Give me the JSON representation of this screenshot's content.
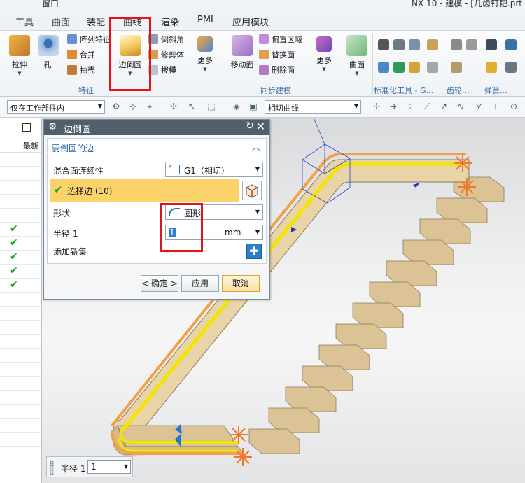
{
  "window": {
    "title": "NX 10 - 建模 - [几齿钉耙.prt",
    "menu_window": "窗口"
  },
  "menubar": {
    "items": [
      "工具",
      "曲面",
      "装配",
      "曲线",
      "渲染",
      "PMI",
      "应用模块"
    ]
  },
  "ribbon": {
    "buttons": {
      "extrude": "拉伸",
      "hole": "孔",
      "pattern": "阵列特征",
      "unite": "合并",
      "shell": "抽壳",
      "edge_blend": "边倒圆",
      "chamfer": "倒斜角",
      "trim_body": "修剪体",
      "draft": "拔模",
      "more1": "更多",
      "move_face": "移动面",
      "offset_region": "偏置区域",
      "replace_face": "替换面",
      "delete_face": "删除面",
      "more2": "更多",
      "surface": "曲面"
    },
    "groups": {
      "feature": "特征",
      "sync": "同步建模",
      "std_tools": "标准化工具 - G...",
      "gear": "齿轮...",
      "spring": "弹簧..."
    }
  },
  "toolbar2": {
    "filter_scope": "仅在工作部件内",
    "curve_rule": "相切曲线"
  },
  "navigator": {
    "column_header": "最新"
  },
  "dialog": {
    "title": "边倒圆",
    "section": "要倒圆的边",
    "continuity_label": "混合面连续性",
    "continuity_value": "G1（相切）",
    "select_edge": "选择边 (10)",
    "shape_label": "形状",
    "shape_value": "圆形",
    "radius_label": "半径 1",
    "radius_value": "1",
    "unit": "mm",
    "add_new_set": "添加新集",
    "ok": "< 确定 >",
    "apply": "应用",
    "cancel": "取消"
  },
  "radius_popup": {
    "label": "半径 1",
    "value": "1"
  },
  "colors": {
    "annotation": "#e3131b",
    "highlight_edge": "#f2e500",
    "selection_row": "#fbd36a",
    "model": "#dcc395"
  }
}
